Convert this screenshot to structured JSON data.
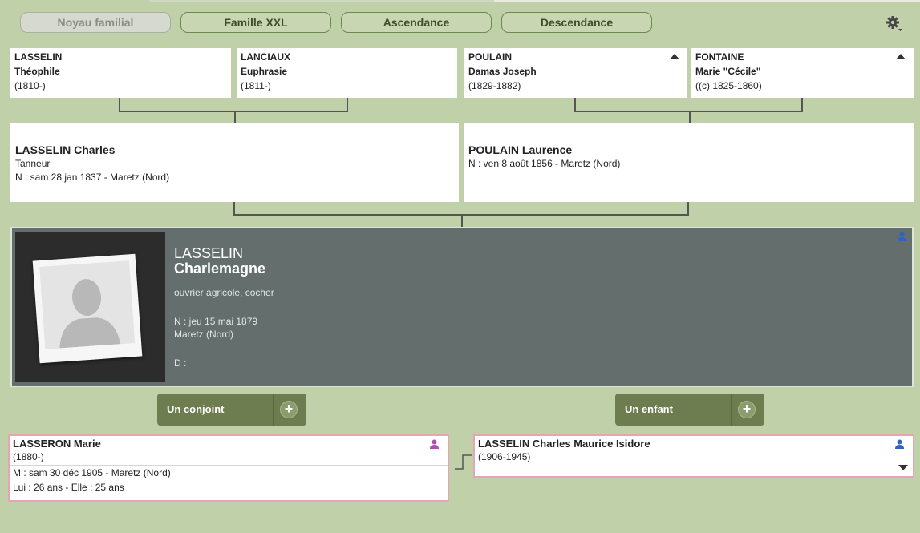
{
  "tabs": [
    {
      "label": "Noyau familial",
      "active": true
    },
    {
      "label": "Famille XXL",
      "active": false
    },
    {
      "label": "Ascendance",
      "active": false
    },
    {
      "label": "Descendance",
      "active": false
    }
  ],
  "grandparents": [
    {
      "surname": "LASSELIN",
      "given": "Théophile",
      "dates": "(1810-)",
      "has_parents": false
    },
    {
      "surname": "LANCIAUX",
      "given": "Euphrasie",
      "dates": "(1811-)",
      "has_parents": false
    },
    {
      "surname": "POULAIN",
      "given": "Damas Joseph",
      "dates": "(1829-1882)",
      "has_parents": true
    },
    {
      "surname": "FONTAINE",
      "given": "Marie \"Cécile\"",
      "dates": "((c) 1825-1860)",
      "has_parents": true
    }
  ],
  "father": {
    "name": "LASSELIN Charles",
    "occupation": "Tanneur",
    "birth": "N : sam 28 jan 1837 - Maretz (Nord)"
  },
  "mother": {
    "name": "POULAIN Laurence",
    "occupation": "",
    "birth": "N : ven 8 août 1856 - Maretz (Nord)"
  },
  "person": {
    "surname": "LASSELIN",
    "given": "Charlemagne",
    "occupation": "ouvrier agricole, cocher",
    "birth_line": "N : jeu 15 mai 1879",
    "birth_place": "Maretz (Nord)",
    "death_line": "D :",
    "gender_icon": "male-person-icon"
  },
  "buttons": {
    "spouse": "Un conjoint",
    "child": "Un enfant",
    "plus": "+"
  },
  "spouse": {
    "name": "LASSERON Marie",
    "dates": "(1880-)",
    "marriage": "M : sam 30 déc 1905 - Maretz (Nord)",
    "ages": "Lui : 26 ans - Elle : 25 ans",
    "gender_icon": "female-person-icon"
  },
  "child": {
    "name": "LASSELIN Charles Maurice Isidore",
    "dates": "(1906-1945)",
    "gender_icon": "male-person-icon"
  },
  "colors": {
    "background": "#c0d0a8",
    "male": "#2c64c8",
    "female": "#b04cb4",
    "main_card": "#636e6d",
    "button": "#6d7d4f"
  }
}
